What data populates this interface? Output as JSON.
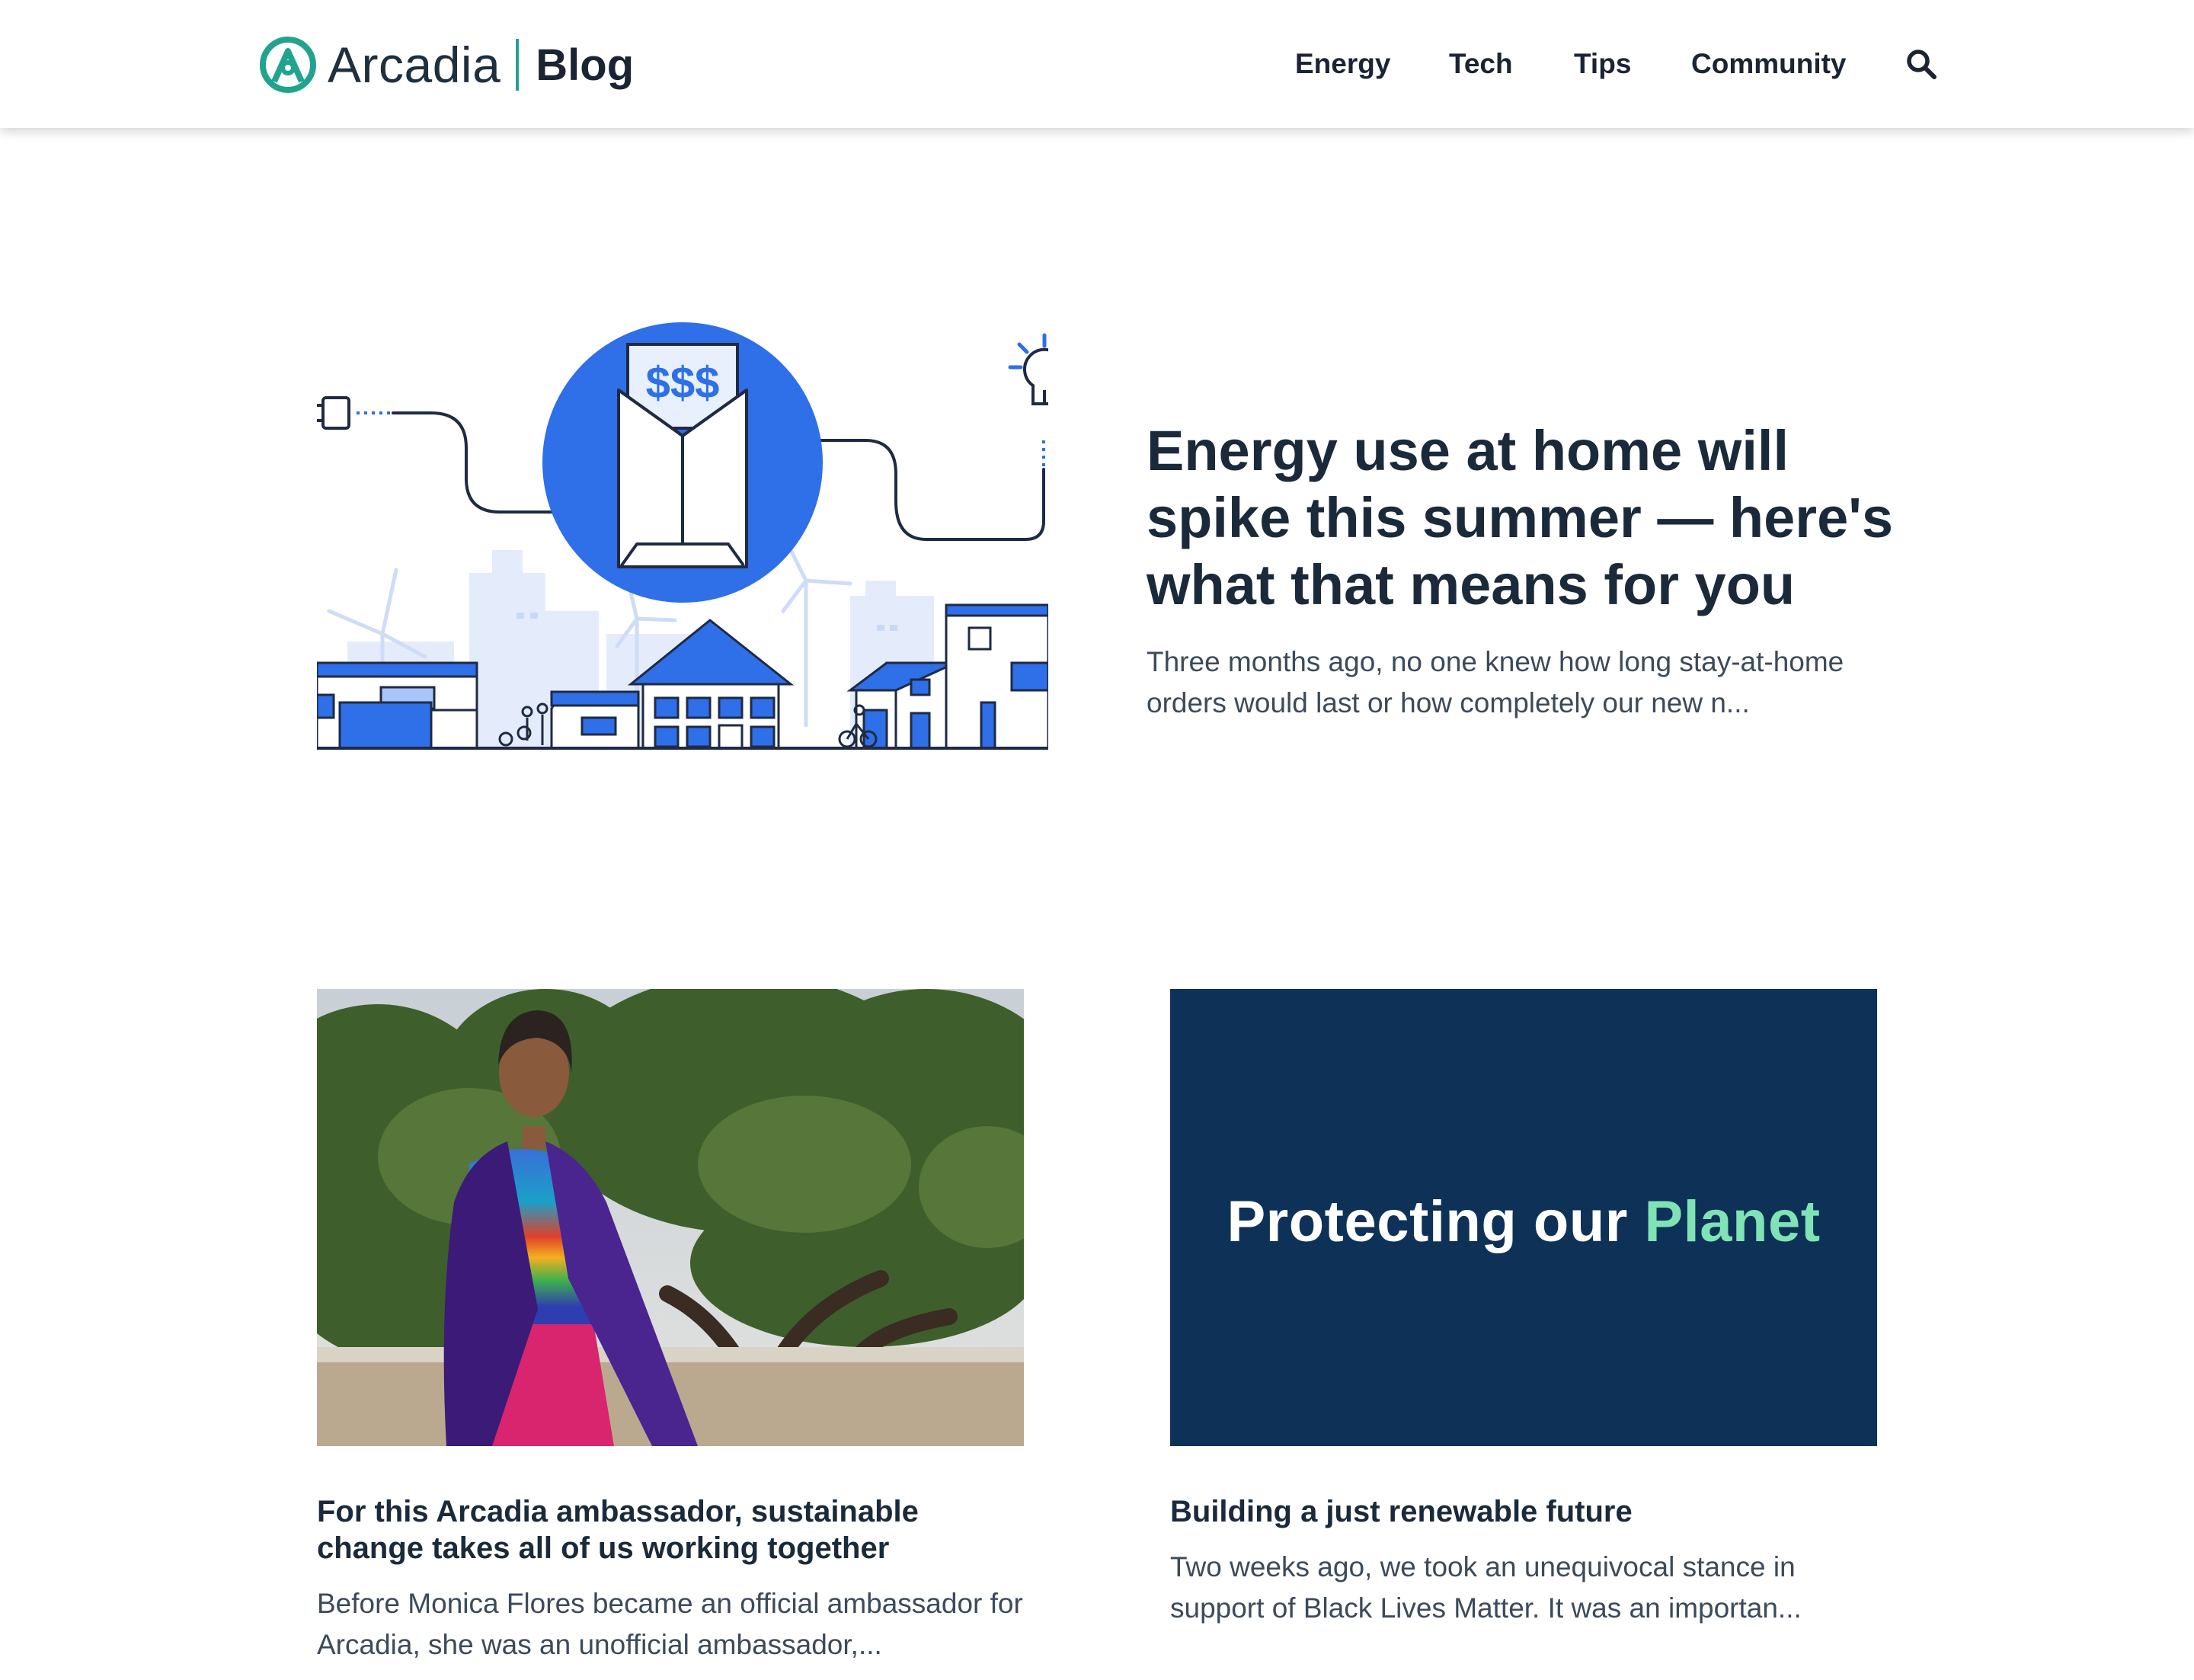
{
  "header": {
    "brand_name": "Arcadia",
    "brand_section": "Blog",
    "nav": [
      "Energy",
      "Tech",
      "Tips",
      "Community"
    ],
    "search_icon": "search-icon"
  },
  "featured": {
    "image_text": "$$$",
    "title": "Energy use at home will spike this summer — here's what that means for you",
    "excerpt": "Three months ago, no one knew how long stay-at-home orders would last or how completely our new n..."
  },
  "cards": [
    {
      "title": "For this Arcadia ambassador, sustainable change takes all of us working together",
      "excerpt": "Before Monica Flores became an official ambassador for Arcadia, she was an unofficial ambassador,..."
    },
    {
      "image_text_main": "Protecting our",
      "image_text_accent": "Planet",
      "title": "Building a just renewable future",
      "excerpt": "Two weeks ago, we took an unequivocal stance in support of Black Lives Matter. It was an importan..."
    }
  ],
  "colors": {
    "brand_teal": "#21a38f",
    "accent_blue": "#2f6fe8",
    "navy_card": "#0e3158",
    "planet_green": "#7fe3b5",
    "text_dark": "#1b2a3a"
  }
}
